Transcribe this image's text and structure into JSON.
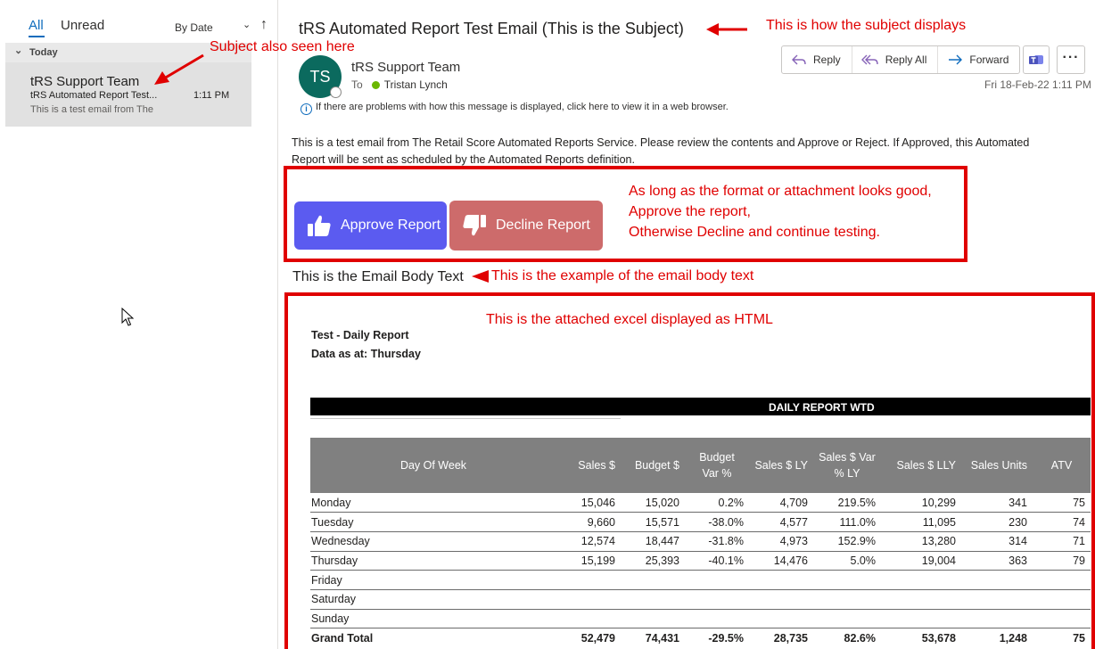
{
  "list": {
    "filters": {
      "all": "All",
      "unread": "Unread",
      "sort": "By Date"
    },
    "group_label": "Today",
    "message": {
      "sender": "tRS Support Team",
      "subject": "tRS Automated Report Test...",
      "time": "1:11 PM",
      "preview": "This is a test email from The"
    }
  },
  "reading": {
    "subject": "tRS Automated Report Test Email (This is the Subject)",
    "avatar_initials": "TS",
    "sender": "tRS Support Team",
    "to_label": "To",
    "recipient": "Tristan Lynch",
    "info_bar": "If there are problems with how this message is displayed, click here to view it in a web browser.",
    "actions": {
      "reply": "Reply",
      "reply_all": "Reply All",
      "forward": "Forward"
    },
    "date": "Fri 18-Feb-22 1:11 PM",
    "body": "This is a test email from The Retail Score Automated Reports Service. Please review the contents and Approve or Reject. If Approved, this Automated Report will be sent as scheduled by the Automated Reports definition.",
    "approve_label": "Approve Report",
    "decline_label": "Decline Report",
    "email_body_text": "This is the Email Body Text"
  },
  "report": {
    "title": "Test - Daily Report",
    "data_as_at": "Data as at: Thursday",
    "banner": "DAILY REPORT WTD",
    "headers": [
      "Day Of Week",
      "Sales $",
      "Budget $",
      "Budget Var %",
      "Sales $ LY",
      "Sales $ Var % LY",
      "Sales $ LLY",
      "Sales Units",
      "ATV"
    ],
    "rows": [
      [
        "Monday",
        "15,046",
        "15,020",
        "0.2%",
        "4,709",
        "219.5%",
        "10,299",
        "341",
        "75"
      ],
      [
        "Tuesday",
        "9,660",
        "15,571",
        "-38.0%",
        "4,577",
        "111.0%",
        "11,095",
        "230",
        "74"
      ],
      [
        "Wednesday",
        "12,574",
        "18,447",
        "-31.8%",
        "4,973",
        "152.9%",
        "13,280",
        "314",
        "71"
      ],
      [
        "Thursday",
        "15,199",
        "25,393",
        "-40.1%",
        "14,476",
        "5.0%",
        "19,004",
        "363",
        "79"
      ],
      [
        "Friday",
        "",
        "",
        "",
        "",
        "",
        "",
        "",
        ""
      ],
      [
        "Saturday",
        "",
        "",
        "",
        "",
        "",
        "",
        "",
        ""
      ],
      [
        "Sunday",
        "",
        "",
        "",
        "",
        "",
        "",
        "",
        ""
      ]
    ],
    "total": [
      "Grand Total",
      "52,479",
      "74,431",
      "-29.5%",
      "28,735",
      "82.6%",
      "53,678",
      "1,248",
      "75"
    ]
  },
  "annotations": {
    "subject_displays": "This is how the subject displays",
    "subject_seen": "Subject also seen here",
    "approve_line1": "As long as the format or attachment looks good,",
    "approve_line2": "Approve the report,",
    "approve_line3": "Otherwise Decline and continue testing.",
    "body_example": "This is the example of the email body text",
    "attached_excel": "This is the attached excel displayed as HTML"
  },
  "colors": {
    "accent": "#0f6cbd",
    "avatar": "#0b6a5e",
    "approve": "#5b5bf0",
    "decline": "#cd6b6b",
    "annotation": "#e00000",
    "table_header": "#808080"
  }
}
